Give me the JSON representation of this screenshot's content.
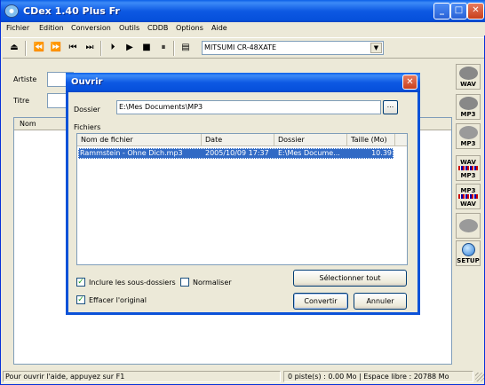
{
  "window": {
    "title": "CDex 1.40 Plus Fr"
  },
  "menu": [
    "Fichier",
    "Edition",
    "Conversion",
    "Outils",
    "CDDB",
    "Options",
    "Aide"
  ],
  "toolbar": {
    "drive": "MITSUMI CR-48XATE"
  },
  "form": {
    "artist_label": "Artiste",
    "title_label": "Titre",
    "name_col": "Nom"
  },
  "sidebar": {
    "icons": [
      {
        "name": "cd-to-wav-icon",
        "label": "WAV"
      },
      {
        "name": "cd-to-mp3-icon",
        "label": "MP3"
      },
      {
        "name": "cd-to-mp3-alt-icon",
        "label": "MP3"
      },
      {
        "name": "wav-to-mp3-icon",
        "top": "WAV",
        "label": "MP3"
      },
      {
        "name": "mp3-to-wav-icon",
        "top": "MP3",
        "label": "WAV"
      },
      {
        "name": "eject-disc-icon",
        "label": ""
      },
      {
        "name": "setup-icon",
        "label": "SETUP"
      }
    ]
  },
  "status": {
    "left": "Pour ouvrir l'aide, appuyez sur F1",
    "right": "0 piste(s) :  0.00 Mo | Espace libre : 20788 Mo"
  },
  "dialog": {
    "title": "Ouvrir",
    "folder_label": "Dossier",
    "folder_path": "E:\\Mes Documents\\MP3",
    "browse_label": "...",
    "files_label": "Fichiers",
    "columns": [
      "Nom de fichier",
      "Date",
      "Dossier",
      "Taille (Mo)"
    ],
    "rows": [
      {
        "file": "Rammstein - Ohne Dich.mp3",
        "date": "2005/10/09 17:37",
        "folder": "E:\\Mes Docume...",
        "size": "10.39"
      }
    ],
    "include_subfolders": "Inclure les sous-dossiers",
    "normalize": "Normaliser",
    "delete_original": "Effacer l'original",
    "select_all": "Sélectionner tout",
    "convert": "Convertir",
    "cancel": "Annuler",
    "checked": {
      "include_subfolders": true,
      "normalize": false,
      "delete_original": true
    }
  }
}
